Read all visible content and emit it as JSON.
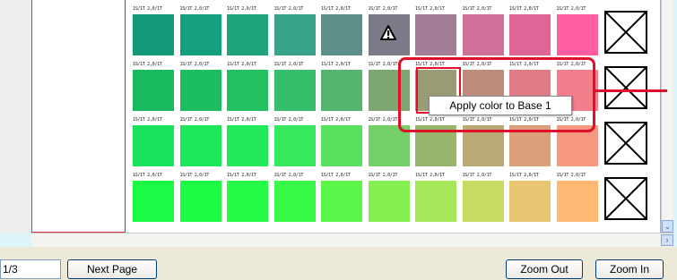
{
  "grid": {
    "cell_code_label": "1S/1T 2,0/1T",
    "rows": [
      [
        "#139a79",
        "#14a07e",
        "#1ea47d",
        "#3aa48b",
        "#5e8e88",
        "#7c7a86",
        "#a37c96",
        "#cf7099",
        "#e06596",
        "#ff5fa0"
      ],
      [
        "#19b95e",
        "#1dbe60",
        "#23c062",
        "#37be6a",
        "#55b46d",
        "#7da671",
        "#9a9a75",
        "#bf8b7d",
        "#e07c86",
        "#f37d8a"
      ],
      [
        "#18e35a",
        "#1de85b",
        "#22ea58",
        "#36e95c",
        "#58e05f",
        "#74cf69",
        "#98b56e",
        "#b9aa75",
        "#dba079",
        "#f69880"
      ],
      [
        "#19fb45",
        "#1efd45",
        "#25fc45",
        "#38fa46",
        "#5cf54a",
        "#83ef50",
        "#a5e65a",
        "#c9da63",
        "#e8c570",
        "#ffb873"
      ]
    ]
  },
  "overlay": {
    "tooltip_text": "Apply color to Base 1",
    "warning_icon": "warning-triangle-icon"
  },
  "status_bar": {
    "page_indicator": "1/3",
    "next_page_label": "Next Page",
    "zoom_out_label": "Zoom Out",
    "zoom_in_label": "Zoom In"
  },
  "colors": {
    "accent_red": "#e0102a",
    "background": "#dff4f9"
  }
}
